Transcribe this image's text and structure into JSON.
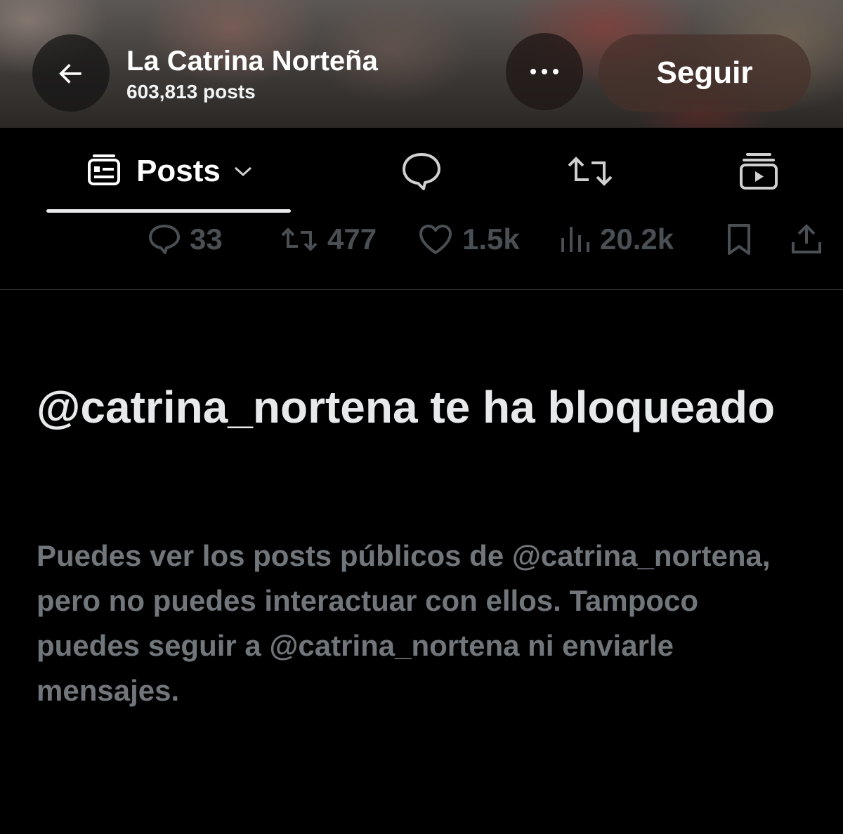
{
  "header": {
    "back_icon": "arrow-left-icon",
    "profile_name": "La Catrina Norteña",
    "post_count": "603,813 posts",
    "more_icon": "more-horizontal-icon",
    "follow_label": "Seguir"
  },
  "tabs": {
    "active": {
      "icon": "post-feed-icon",
      "label": "Posts",
      "dropdown_icon": "chevron-down-icon"
    },
    "replies_icon": "speech-bubble-icon",
    "reposts_icon": "repost-icon",
    "media_icon": "media-stack-icon"
  },
  "post_actions": {
    "replies": "33",
    "reposts": "477",
    "likes": "1.5k",
    "views": "20.2k",
    "bookmark_icon": "bookmark-icon",
    "share_icon": "share-icon"
  },
  "blocked": {
    "title": "@catrina_nortena te ha bloqueado",
    "body": "Puedes ver los posts públicos de @catrina_nortena, pero no puedes interactuar con ellos. Tampoco puedes seguir a @catrina_nortena ni enviarle mensajes."
  },
  "colors": {
    "background": "#000000",
    "primary_text": "#e7e9ea",
    "secondary_text": "#71767b",
    "muted_action": "#4a4f54"
  }
}
